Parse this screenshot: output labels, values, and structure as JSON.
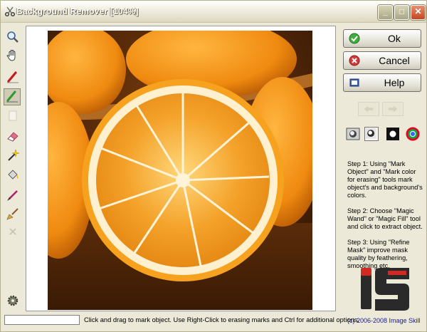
{
  "window": {
    "title": "Background Remover [104%]",
    "minimize_glyph": "_",
    "maximize_glyph": "□",
    "close_glyph": "✕"
  },
  "toolbar": {
    "tools": [
      {
        "name": "zoom-tool",
        "icon": "magnifier-icon"
      },
      {
        "name": "hand-tool",
        "icon": "hand-icon"
      },
      {
        "name": "mark-object-tool",
        "icon": "red-marker-icon"
      },
      {
        "name": "mark-color-tool",
        "icon": "green-marker-icon"
      },
      {
        "name": "blank-tool",
        "icon": "blank-page-icon"
      },
      {
        "name": "eraser-tool",
        "icon": "eraser-icon"
      },
      {
        "name": "magic-wand-tool",
        "icon": "magic-wand-icon"
      },
      {
        "name": "magic-fill-tool",
        "icon": "bucket-icon"
      },
      {
        "name": "brush-tool",
        "icon": "brush-icon"
      },
      {
        "name": "broom-tool",
        "icon": "broom-icon"
      },
      {
        "name": "clear-tool",
        "icon": "x-icon"
      },
      {
        "name": "settings-tool",
        "icon": "gear-icon"
      }
    ]
  },
  "buttons": {
    "ok": "Ok",
    "cancel": "Cancel",
    "help": "Help"
  },
  "instructions": {
    "step1": "Step 1: Using \"Mark Object\" and \"Mark color for erasing\" tools mark object's and background's colors.",
    "step2": "Step 2: Choose \"Magic Wand\" or \"Magic Fill\" tool and click to extract object.",
    "step3": "Step 3: Using \"Refine Mask\" improve mask quality by feathering, smoothing etc."
  },
  "copyright": "(c) 2006-2008 Image Skill",
  "status_text": "Click and drag to mark object. Use Right-Click to erasing marks and Ctrl for additional options.",
  "colors": {
    "chrome": "#ece9d8",
    "orange": "#f39a1a",
    "logo_red": "#d12a22",
    "logo_dark": "#2a2a2a"
  }
}
